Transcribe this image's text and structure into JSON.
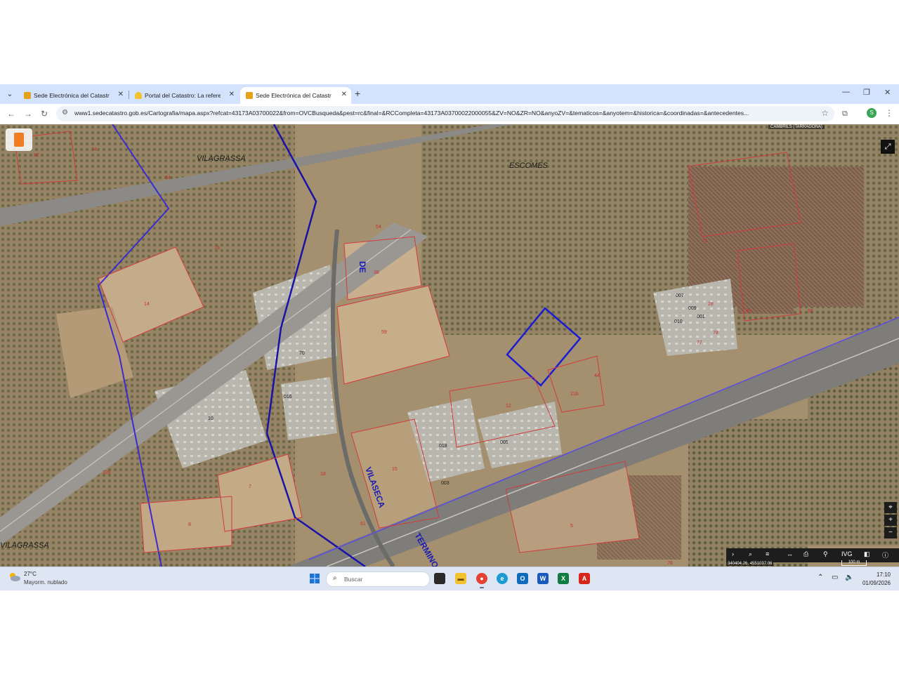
{
  "browser": {
    "tabs": [
      {
        "title": "Sede Electrónica del Catastro -",
        "active": false,
        "favicon_color": "#e3a21a"
      },
      {
        "title": "Portal del Catastro: La referenci",
        "active": false,
        "favicon_color": "#f2c12e"
      },
      {
        "title": "Sede Electrónica del Catastro -",
        "active": true,
        "favicon_color": "#e3a21a"
      }
    ],
    "url_host": "www1.sedecatastro.gob.es",
    "url_rest": "/Cartografia/mapa.aspx?refcat=43173A03700022&from=OVCBusqueda&pest=rc&final=&RCCompleta=43173A03700022000055&ZV=NO&ZR=NO&anyoZV=&tematicos=&anyotem=&historica=&coordinadas=&antecedentes...",
    "profile_initial": "S"
  },
  "map": {
    "municipality": "CAMBRILS (TARRAGONA)",
    "place_labels": [
      "VILAGRASSA",
      "ESCOMES",
      "VILAGRASSA",
      "DE",
      "VILASECA",
      "TERMINO"
    ],
    "parcel_labels": [
      "82",
      "74",
      "84",
      "16",
      "14",
      "54",
      "38",
      "59",
      "70",
      "10",
      "109",
      "7",
      "8",
      "18",
      "15",
      "61",
      "016",
      "005",
      "018",
      "003",
      "12",
      "21b",
      "44",
      "71",
      "007",
      "009",
      "010",
      "001",
      "77",
      "78",
      "28",
      "45",
      "58",
      "5",
      "78"
    ],
    "coordinates": "340404.26, 4551037.06",
    "scale_label": "100 m",
    "toolbar_label": "IVG"
  },
  "taskbar": {
    "temperature": "27°C",
    "weather": "Mayorm. nublado",
    "search_placeholder": "Buscar",
    "time": "17:10",
    "date": "01/09/2026"
  }
}
